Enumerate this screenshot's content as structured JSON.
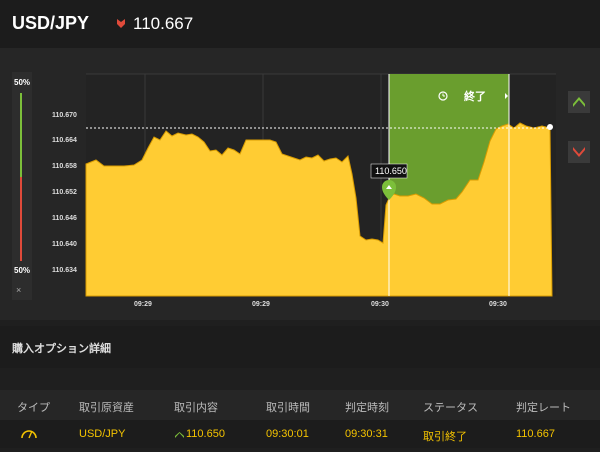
{
  "header": {
    "pair": "USD/JPY",
    "price": "110.667"
  },
  "gauge": {
    "top_pct": "50%",
    "bottom_pct": "50%",
    "close": "×"
  },
  "chart": {
    "y_ticks": [
      "110.670",
      "110.664",
      "110.658",
      "110.652",
      "110.646",
      "110.640",
      "110.634"
    ],
    "x_ticks": [
      "09:29",
      "09:29",
      "09:30",
      "09:30"
    ],
    "entry_label": "110.650",
    "end_label": "終了",
    "colors": {
      "area": "#ffcc33",
      "window": "#6a9e2e",
      "entry": "#7cbf3a"
    }
  },
  "details": {
    "title": "購入オプション詳細",
    "columns": [
      "タイプ",
      "取引原資産",
      "取引内容",
      "取引時間",
      "判定時刻",
      "ステータス",
      "判定レート"
    ],
    "row": {
      "asset": "USD/JPY",
      "content": "110.650",
      "time": "09:30:01",
      "judge_time": "09:30:31",
      "status": "取引終了",
      "rate": "110.667"
    }
  }
}
